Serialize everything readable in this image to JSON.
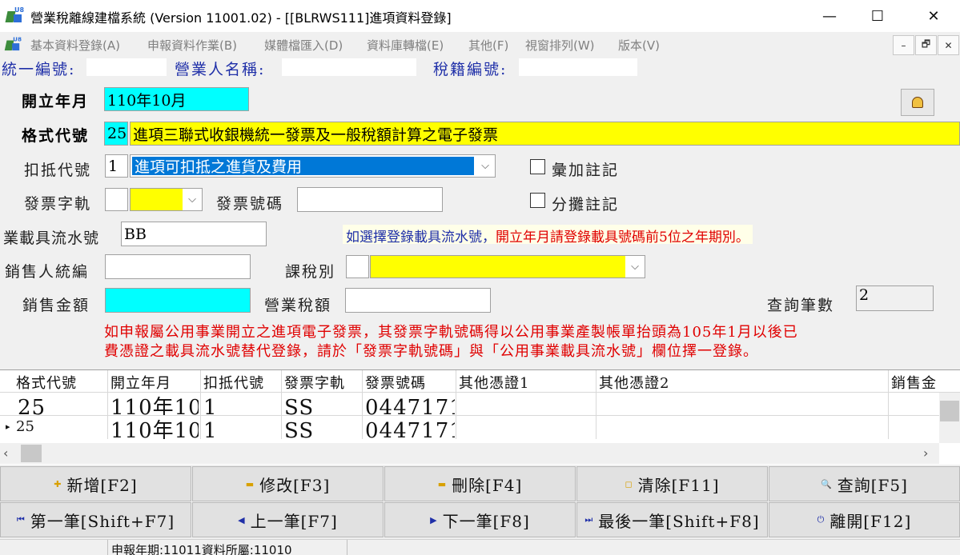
{
  "window": {
    "title": "營業稅離線建檔系統 (Version 11001.02) - [[BLRWS111]進項資料登錄]",
    "minimize": "—",
    "maximize": "☐",
    "close": "✕"
  },
  "menu": {
    "items": [
      "基本資料登錄(A)",
      "申報資料作業(B)",
      "媒體檔匯入(D)",
      "資料庫轉檔(E)",
      "其他(F)",
      "視窗排列(W)",
      "版本(V)"
    ],
    "mdi_minimize": "–",
    "mdi_restore": "🗗",
    "mdi_close": "✕"
  },
  "info": {
    "uniform_no_label": "統一編號:",
    "business_name_label": "營業人名稱:",
    "tax_reg_label": "稅籍編號:"
  },
  "form": {
    "open_month_label": "開立年月",
    "open_month_value": "110年10月",
    "format_code_label": "格式代號",
    "format_code_value": "25",
    "format_code_desc": "進項三聯式收銀機統一發票及一般稅額計算之電子發票",
    "deduct_code_label": "扣抵代號",
    "deduct_code_value": "1",
    "deduct_code_desc": "進項可扣抵之進貨及費用",
    "aggregate_label": "彙加註記",
    "invoice_track_label": "發票字軌",
    "invoice_track_value": "",
    "invoice_no_label": "發票號碼",
    "invoice_no_value": "",
    "apportion_label": "分攤註記",
    "carrier_label": "業載具流水號",
    "carrier_value": "BB",
    "carrier_note": {
      "part1": "如選擇登錄載具流水號，",
      "part2": "開立年月請登錄載具號碼前5位之",
      "part3": "年期別。"
    },
    "seller_id_label": "銷售人統編",
    "seller_id_value": "",
    "tax_type_label": "課稅別",
    "tax_type_value": "",
    "sales_amount_label": "銷售金額",
    "sales_amount_value": "",
    "business_tax_label": "營業稅額",
    "business_tax_value": "",
    "query_count_label": "查詢筆數",
    "query_count_value": "2",
    "warning_line1": "如申報屬公用事業開立之進項電子發票，其發票字軌號碼得以公用事業產製帳單抬頭為105年1月以後已",
    "warning_line2": "費憑證之載具流水號替代登錄，請於「發票字軌號碼」與「公用事業載具流水號」欄位擇一登錄。"
  },
  "grid": {
    "headers": [
      "格式代號",
      "開立年月",
      "扣抵代號",
      "發票字軌",
      "發票號碼",
      "其他憑證1",
      "其他憑證2",
      "銷售金"
    ],
    "rows": [
      [
        "25",
        "110年10",
        "1",
        "SS",
        "0447171",
        "",
        "",
        ""
      ],
      [
        "25",
        "110年10",
        "1",
        "SS",
        "0447171",
        "",
        "",
        ""
      ]
    ],
    "row_indicator": "▸"
  },
  "buttons": {
    "add": "新增[F2]",
    "edit": "修改[F3]",
    "delete": "刪除[F4]",
    "clear": "清除[F11]",
    "query": "查詢[F5]",
    "first": "第一筆[Shift+F7]",
    "prev": "上一筆[F7]",
    "next": "下一筆[F8]",
    "last": "最後一筆[Shift+F8]",
    "exit": "離開[F12]"
  },
  "status": {
    "text": "申報年期:11011資料所屬:11010"
  },
  "colors": {
    "label_blue": "#1f2fa8",
    "field_cyan": "#00ffff",
    "field_yellow": "#ffff00",
    "warning_red": "#e00000",
    "selection_blue": "#0078d7"
  }
}
